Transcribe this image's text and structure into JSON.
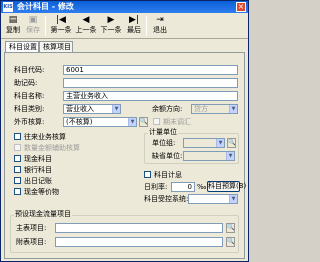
{
  "window": {
    "app_icon": "KIS",
    "title": "会计科目 - 修改"
  },
  "toolbar": {
    "save": "复制",
    "keep": "保存",
    "first": "第一条",
    "prev": "上一条",
    "next": "下一条",
    "last": "最后",
    "exit": "退出"
  },
  "tabs": [
    "科目设置",
    "核算项目"
  ],
  "form": {
    "code_label": "科目代码:",
    "code_value": "6001",
    "mnemonic_label": "助记码:",
    "mnemonic_value": "",
    "name_label": "科目名称:",
    "name_value": "主营业务收入",
    "category_label": "科目类别:",
    "category_value": "营业收入",
    "balance_dir_label": "余额方向:",
    "balance_dir_value": "贷方",
    "fx_label": "外币核算:",
    "fx_value": "(不核算)",
    "fx_adjust_label": "期末调汇",
    "checkboxes": [
      "往来业务核算",
      "数量金额辅助核算",
      "现金科目",
      "银行科目",
      "出日记账",
      "现金等价物"
    ],
    "unit_group_title": "计量单位",
    "unit_group_label": "单位组:",
    "default_unit_label": "缺省单位:",
    "interest_label": "科目计息",
    "daily_rate_label": "日利率:",
    "daily_rate_value": "0",
    "percent_sign": "‰",
    "budget_button": "科目预算(B)",
    "control_sys_label": "科目受控系统:",
    "cashflow_group_title": "预设现金流量项目",
    "main_item_label": "主表项目:",
    "sub_item_label": "附表项目:"
  }
}
